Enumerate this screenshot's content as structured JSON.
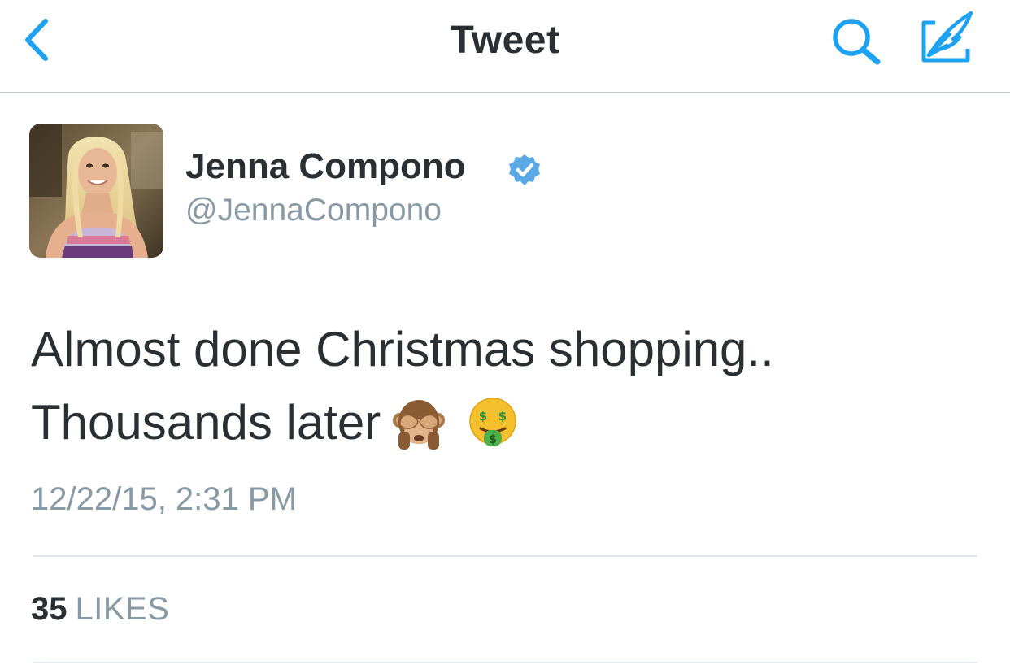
{
  "navbar": {
    "title": "Tweet",
    "back_icon": "chevron-left-icon",
    "search_icon": "search-icon",
    "compose_icon": "compose-tweet-icon",
    "accent_color": "#1da1f2"
  },
  "tweet": {
    "author": {
      "display_name": "Jenna Compono",
      "handle": "@JennaCompono",
      "verified": true,
      "verified_icon": "verified-badge-icon",
      "avatar": "profile-photo"
    },
    "text_lines": [
      "Almost done Christmas shopping..",
      "Thousands later"
    ],
    "emojis": [
      "see-no-evil-monkey-emoji",
      "money-mouth-face-emoji"
    ],
    "timestamp": "12/22/15, 2:31 PM",
    "likes": {
      "count": "35",
      "label": "LIKES"
    }
  },
  "colors": {
    "text_primary": "#292f33",
    "text_secondary": "#8899a6",
    "accent": "#1da1f2",
    "divider": "#e1e8ed"
  }
}
